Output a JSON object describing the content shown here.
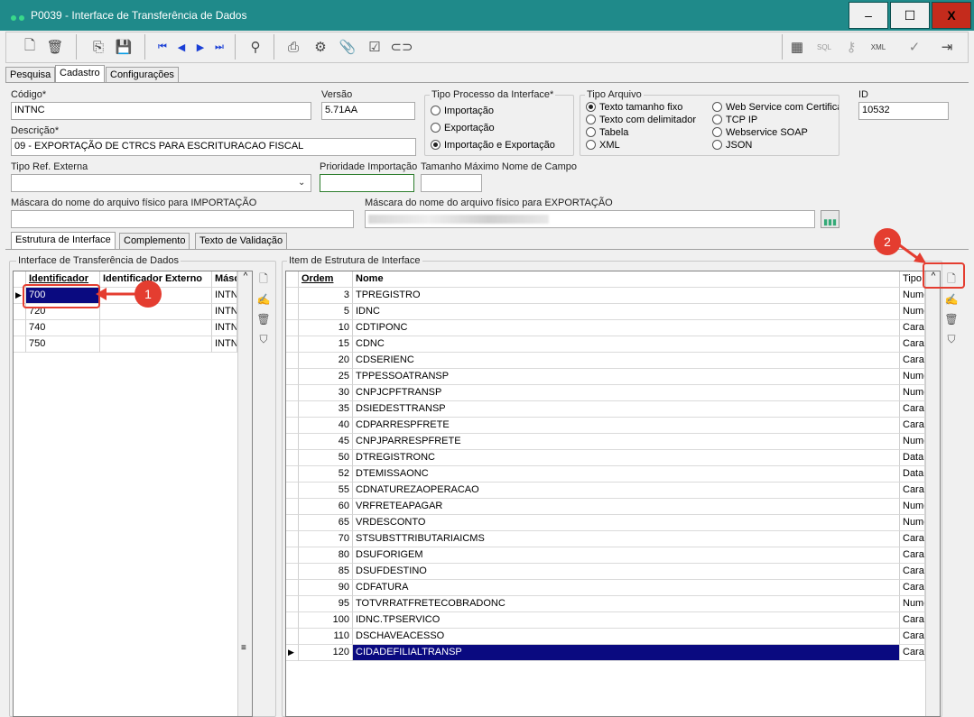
{
  "window": {
    "title": "P0039 - Interface de Transferência de Dados",
    "minimize": "‒",
    "maximize": "☐",
    "close": "X"
  },
  "tabs": [
    "Pesquisa",
    "Cadastro",
    "Configurações"
  ],
  "form": {
    "codigo_label": "Código*",
    "codigo": "INTNC",
    "versao_label": "Versão",
    "versao": "5.71AA",
    "descricao_label": "Descrição*",
    "descricao": "09 - EXPORTAÇÃO DE CTRCS PARA ESCRITURACAO FISCAL",
    "tipo_processo_label": "Tipo Processo da Interface*",
    "tipo_processo_options": [
      "Importação",
      "Exportação",
      "Importação e Exportação"
    ],
    "tipo_arquivo_label": "Tipo Arquivo",
    "tipo_arquivo_col1": [
      "Texto tamanho fixo",
      "Texto com delimitador",
      "Tabela",
      "XML"
    ],
    "tipo_arquivo_col2": [
      "Web Service com Certifica",
      "TCP IP",
      "Webservice SOAP",
      "JSON"
    ],
    "id_label": "ID",
    "id": "10532",
    "tipo_ref_label": "Tipo Ref. Externa",
    "prioridade_label": "Prioridade Importação",
    "tamanho_label": "Tamanho Máximo Nome de Campo",
    "mascara_imp_label": "Máscara do nome do arquivo físico para IMPORTAÇÃO",
    "mascara_exp_label": "Máscara do nome do arquivo físico para EXPORTAÇÃO"
  },
  "subtabs": [
    "Estrutura de Interface",
    "Complemento",
    "Texto de Validação"
  ],
  "left_grid": {
    "title": "Interface de Transferência de Dados",
    "headers": [
      "Identificador",
      "Identificador Externo",
      "Másc"
    ],
    "rows": [
      [
        "700",
        "",
        "INTN"
      ],
      [
        "720",
        "",
        "INTN"
      ],
      [
        "740",
        "",
        "INTN"
      ],
      [
        "750",
        "",
        "INTN"
      ]
    ]
  },
  "right_grid": {
    "title": "Item de Estrutura de Interface",
    "headers": [
      "Ordem",
      "Nome",
      "Tipo"
    ],
    "rows": [
      [
        "3",
        "TPREGISTRO",
        "Nume"
      ],
      [
        "5",
        "IDNC",
        "Nume"
      ],
      [
        "10",
        "CDTIPONC",
        "Cara"
      ],
      [
        "15",
        "CDNC",
        "Cara"
      ],
      [
        "20",
        "CDSERIENC",
        "Cara"
      ],
      [
        "25",
        "TPPESSOATRANSP",
        "Nume"
      ],
      [
        "30",
        "CNPJCPFTRANSP",
        "Nume"
      ],
      [
        "35",
        "DSIEDESTTRANSP",
        "Cara"
      ],
      [
        "40",
        "CDPARRESPFRETE",
        "Cara"
      ],
      [
        "45",
        "CNPJPARRESPFRETE",
        "Nume"
      ],
      [
        "50",
        "DTREGISTRONC",
        "Data"
      ],
      [
        "52",
        "DTEMISSAONC",
        "Data"
      ],
      [
        "55",
        "CDNATUREZAOPERACAO",
        "Cara"
      ],
      [
        "60",
        "VRFRETEAPAGAR",
        "Nume"
      ],
      [
        "65",
        "VRDESCONTO",
        "Nume"
      ],
      [
        "70",
        "STSUBSTTRIBUTARIAICMS",
        "Cara"
      ],
      [
        "80",
        "DSUFORIGEM",
        "Cara"
      ],
      [
        "85",
        "DSUFDESTINO",
        "Cara"
      ],
      [
        "90",
        "CDFATURA",
        "Cara"
      ],
      [
        "95",
        "TOTVRRATFRETECOBRADONC",
        "Nume"
      ],
      [
        "100",
        "IDNC.TPSERVICO",
        "Cara"
      ],
      [
        "110",
        "DSCHAVEACESSO",
        "Cara"
      ],
      [
        "120",
        "CIDADEFILIALTRANSP",
        "Cara"
      ]
    ]
  },
  "annotations": [
    "1",
    "2"
  ],
  "colors": {
    "titlebar": "#1f8a8a",
    "selection": "#0a0a80",
    "annotation": "#e43d30"
  },
  "toolbar_icons": [
    "new-icon",
    "delete-icon",
    "copy-icon",
    "save-icon",
    "first-icon",
    "prev-icon",
    "next-icon",
    "last-icon",
    "binoculars-icon",
    "print-icon",
    "gear-icon",
    "attach-icon",
    "check-icon",
    "link-icon",
    "calculator-icon",
    "sql-icon",
    "search-icon",
    "xml-icon",
    "confirm-icon",
    "exit-icon"
  ]
}
